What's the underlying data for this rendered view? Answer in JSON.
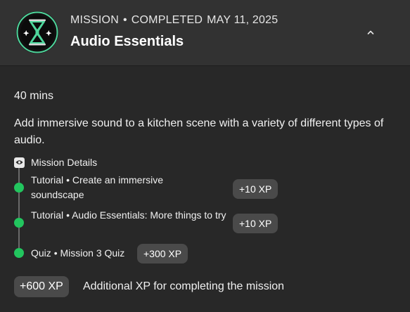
{
  "header": {
    "label": "MISSION",
    "separator": "•",
    "status": "COMPLETED",
    "date": "MAY 11, 2025",
    "title": "Audio Essentials"
  },
  "mission": {
    "duration": "40 mins",
    "description": "Add immersive sound to a kitchen scene with a variety of different types of audio.",
    "details_label": "Mission Details",
    "items": [
      {
        "type": "Tutorial",
        "sep": "•",
        "name": "Create an immersive soundscape",
        "xp": "+10 XP"
      },
      {
        "type": "Tutorial",
        "sep": "•",
        "name": "Audio Essentials: More things to try",
        "xp": "+10 XP"
      },
      {
        "type": "Quiz",
        "sep": "•",
        "name": "Mission 3 Quiz",
        "xp": "+300 XP"
      }
    ],
    "bonus_xp": "+600 XP",
    "bonus_text": "Additional XP for completing the mission"
  },
  "colors": {
    "header_bg": "#323232",
    "body_bg": "#282828",
    "badge_green": "#4fd69c",
    "complete_dot": "#22c55e",
    "pill_bg": "#4a4a4a"
  },
  "icons": {
    "badge": "hourglass-badge-icon",
    "collapse": "chevron-up-icon",
    "details": "eye-icon",
    "item_status": "completed-dot-icon"
  }
}
